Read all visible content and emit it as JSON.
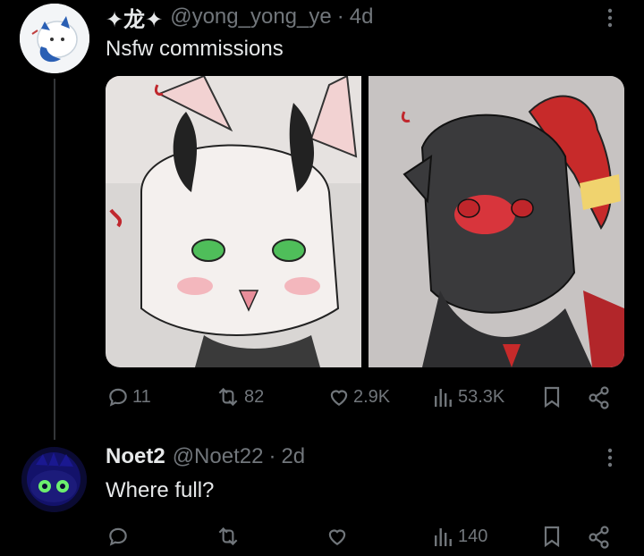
{
  "tweet": {
    "author_name": "✦龙✦",
    "author_handle": "@yong_yong_ye",
    "separator": "·",
    "time": "4d",
    "text": "Nsfw commissions",
    "actions": {
      "replies": "11",
      "reposts": "82",
      "likes": "2.9K",
      "views": "53.3K"
    }
  },
  "reply": {
    "author_name": "Noet2",
    "author_handle": "@Noet22",
    "separator": "·",
    "time": "2d",
    "text": "Where full?",
    "actions": {
      "replies": "",
      "reposts": "",
      "likes": "",
      "views": "140"
    }
  },
  "icons": {
    "reply": "reply-icon",
    "repost": "repost-icon",
    "like": "heart-icon",
    "views": "views-icon",
    "bookmark": "bookmark-icon",
    "share": "share-icon",
    "more": "more-icon"
  },
  "colors": {
    "background": "#000000",
    "text": "#e7e9ea",
    "muted": "#71767b"
  }
}
